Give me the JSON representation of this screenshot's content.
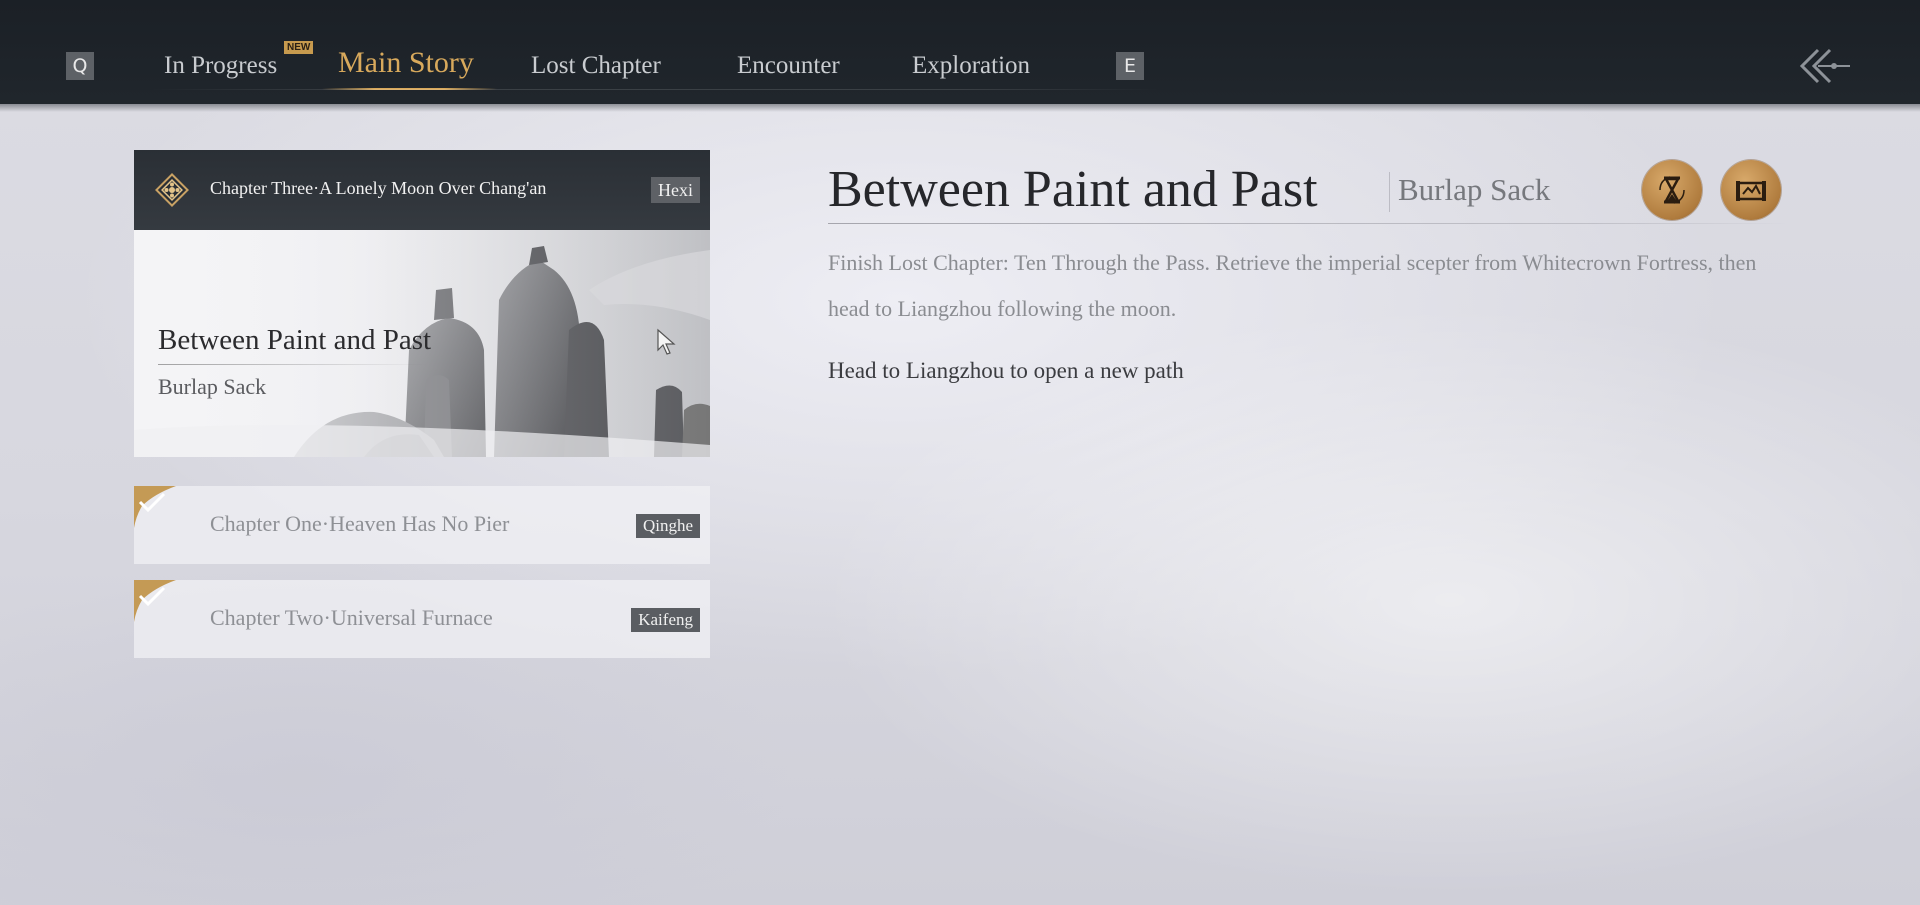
{
  "nav": {
    "left_key": "Q",
    "right_key": "E",
    "new_badge": "NEW",
    "tabs": [
      {
        "label": "In Progress"
      },
      {
        "label": "Main Story"
      },
      {
        "label": "Lost Chapter"
      },
      {
        "label": "Encounter"
      },
      {
        "label": "Exploration"
      }
    ],
    "active_tab": "Main Story"
  },
  "featured": {
    "chapter": "Chapter Three·A Lonely Moon Over Chang'an",
    "region": "Hexi",
    "quest_title": "Between Paint and Past",
    "quest_subtitle": "Burlap Sack"
  },
  "chapters": [
    {
      "label": "Chapter One·Heaven Has No Pier",
      "region": "Qinghe",
      "completed": true
    },
    {
      "label": "Chapter Two·Universal Furnace",
      "region": "Kaifeng",
      "completed": true
    }
  ],
  "detail": {
    "title": "Between Paint and Past",
    "subtitle": "Burlap Sack",
    "description": "Finish Lost Chapter: Ten Through the Pass. Retrieve the imperial scepter from Whitecrown Fortress, then head to Liangzhou following the moon.",
    "objective": "Head to Liangzhou to open a new path",
    "reward_icons": [
      "hourglass-icon",
      "map-scroll-icon"
    ]
  },
  "colors": {
    "accent": "#d8a95c",
    "topbar": "#1d2228",
    "reward": "#c08a4a"
  }
}
